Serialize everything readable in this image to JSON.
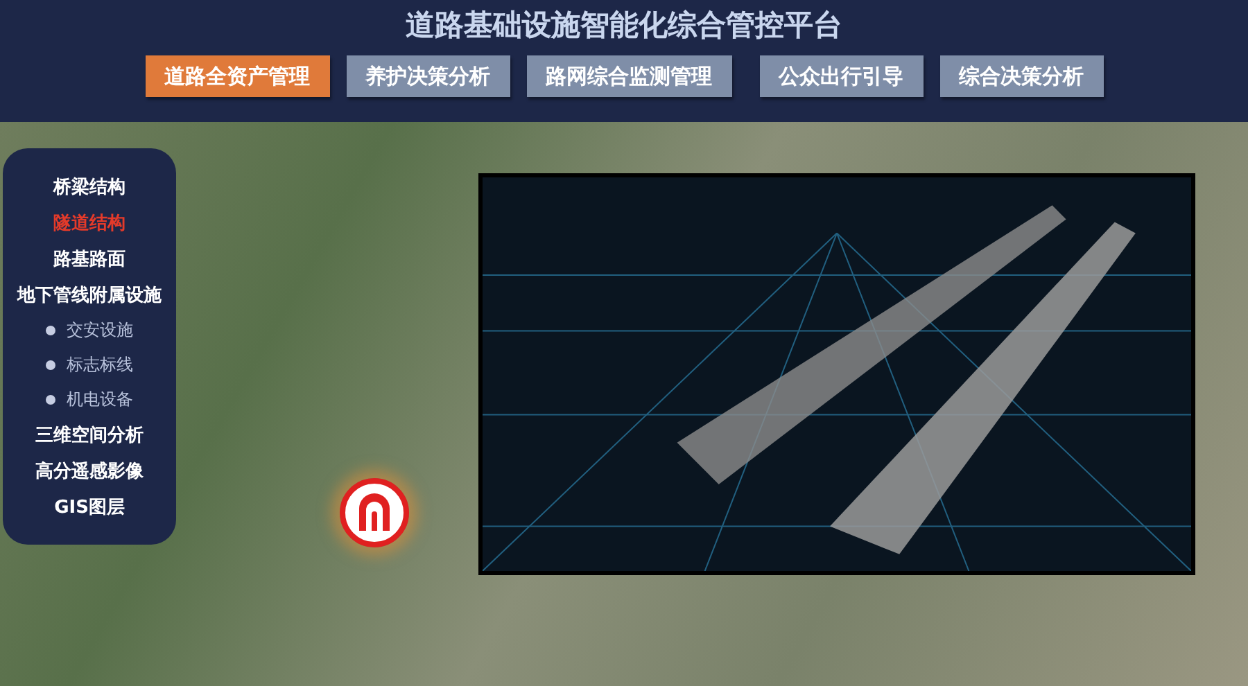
{
  "header": {
    "title": "道路基础设施智能化综合管控平台"
  },
  "tabs": [
    {
      "label": "道路全资产管理",
      "selected": true
    },
    {
      "label": "养护决策分析",
      "selected": false
    },
    {
      "label": "路网综合监测管理",
      "selected": false
    },
    {
      "label": "公众出行引导",
      "selected": false
    },
    {
      "label": "综合决策分析",
      "selected": false
    }
  ],
  "sidebar": {
    "items": [
      {
        "label": "桥梁结构",
        "kind": "item",
        "selected": false
      },
      {
        "label": "隧道结构",
        "kind": "item",
        "selected": true
      },
      {
        "label": "路基路面",
        "kind": "item",
        "selected": false
      },
      {
        "label": "地下管线附属设施",
        "kind": "item",
        "selected": false
      },
      {
        "label": "交安设施",
        "kind": "sub",
        "selected": false
      },
      {
        "label": "标志标线",
        "kind": "sub",
        "selected": false
      },
      {
        "label": "机电设备",
        "kind": "sub",
        "selected": false
      },
      {
        "label": "三维空间分析",
        "kind": "item",
        "selected": false
      },
      {
        "label": "高分遥感影像",
        "kind": "item",
        "selected": false
      },
      {
        "label": "GIS图层",
        "kind": "item",
        "selected": false
      }
    ]
  }
}
